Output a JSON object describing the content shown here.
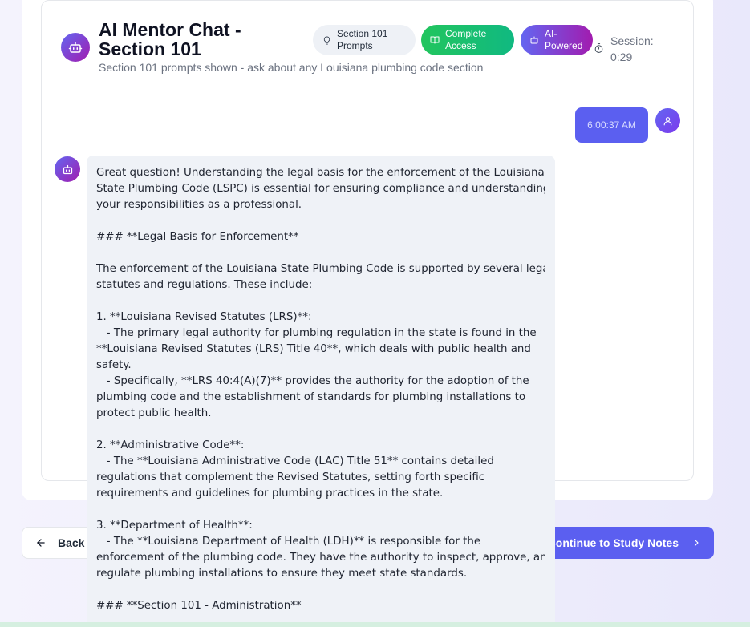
{
  "header": {
    "title": "AI Mentor Chat - Section 101",
    "subtitle": "Section 101 prompts shown - ask about any Louisiana plumbing code section",
    "badges": {
      "prompts": "Section 101 Prompts",
      "access": "Complete Access",
      "ai": "AI-Powered"
    },
    "session": "Session: 0:29",
    "icons": [
      "bot-icon",
      "lightbulb-icon",
      "book-icon",
      "sparkle-icon",
      "timer-icon"
    ]
  },
  "messages": {
    "user_time": "6:00:37 AM",
    "bot_lines": [
      "Great question! Understanding the legal basis for the enforcement of the Louisiana",
      "State Plumbing Code (LSPC) is essential for ensuring compliance and understanding",
      "your responsibilities as a professional.",
      "",
      "### **Legal Basis for Enforcement**",
      "",
      "The enforcement of the Louisiana State Plumbing Code is supported by several legal",
      "statutes and regulations. These include:",
      "",
      "1. **Louisiana Revised Statutes (LRS)**:",
      "   - The primary legal authority for plumbing regulation in the state is found in the",
      "**Louisiana Revised Statutes (LRS) Title 40**, which deals with public health and",
      "safety.",
      "   - Specifically, **LRS 40:4(A)(7)** provides the authority for the adoption of the",
      "plumbing code and the establishment of standards for plumbing installations to",
      "protect public health.",
      "",
      "2. **Administrative Code**:",
      "   - The **Louisiana Administrative Code (LAC) Title 51** contains detailed",
      "regulations that complement the Revised Statutes, setting forth specific",
      "requirements and guidelines for plumbing practices in the state.",
      "",
      "3. **Department of Health**:",
      "   - The **Louisiana Department of Health (LDH)** is responsible for the",
      "enforcement of the plumbing code. They have the authority to inspect, approve, and",
      "regulate plumbing installations to ensure they meet state standards.",
      "",
      "### **Section 101 - Administration**"
    ]
  },
  "footer": {
    "back_label": "Back",
    "continue_label": "Continue to Study Notes"
  },
  "colors": {
    "accent": "#5b5ff0",
    "success": "#22c55e",
    "ai_gradient_end": "#a21caf"
  }
}
